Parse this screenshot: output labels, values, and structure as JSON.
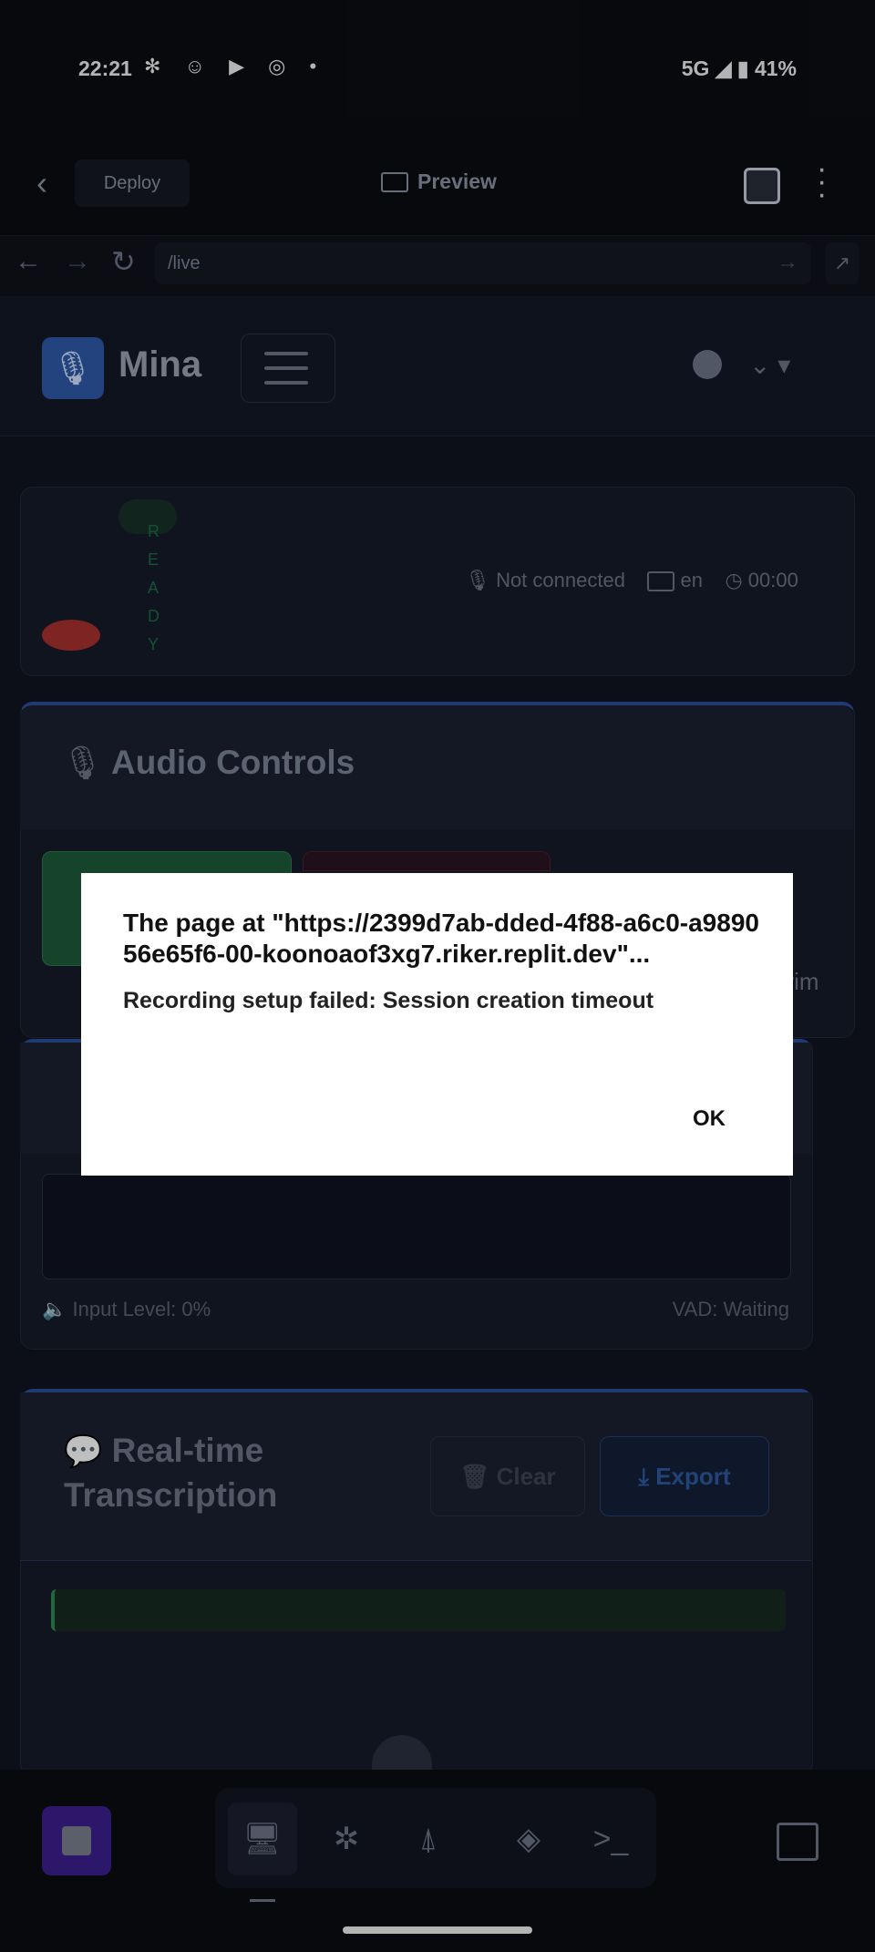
{
  "statusbar": {
    "time": "22:21",
    "app_icons": "✻ ☺ ▶ ◎ •",
    "right": "5G ◢ ▮ 41%"
  },
  "toolbar": {
    "deploy_label": "Deploy",
    "preview_label": "Preview"
  },
  "urlbar": {
    "path": "/live"
  },
  "navbar": {
    "brand": "Mina"
  },
  "status_card": {
    "ready_letters": [
      "R",
      "E",
      "A",
      "D",
      "Y"
    ],
    "connection": "Not connected",
    "language": "en",
    "timer": "00:00"
  },
  "audio": {
    "title": "Audio Controls",
    "partial_right": "erim"
  },
  "visualizer": {
    "input_level": "Input Level: 0%",
    "vad": "VAD: Waiting"
  },
  "transcription": {
    "title_line1": "Real-time",
    "title_line2": "Transcription",
    "clear_label": "Clear",
    "export_label": "Export"
  },
  "dialog": {
    "title": "The page at \"https://2399d7ab-dded-4f88-a6c0-a989056e65f6-00-koonoaof3xg7.riker.replit.dev\"...",
    "message": "Recording setup failed: Session creation timeout",
    "ok_label": "OK"
  },
  "colors": {
    "accent": "#2b4e9a",
    "brand_mic": "#2e5aa8",
    "record": "#a8312e",
    "stop": "#3b1f8f"
  }
}
